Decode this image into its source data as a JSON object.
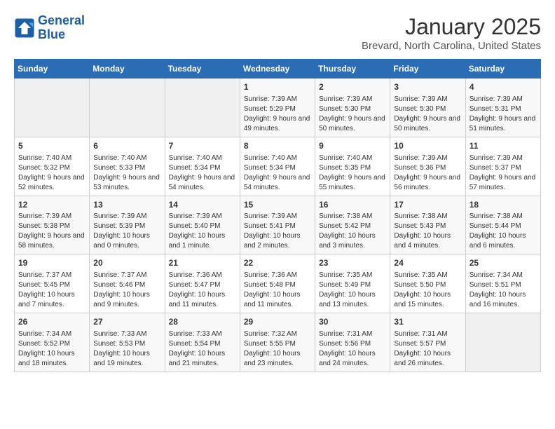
{
  "logo": {
    "line1": "General",
    "line2": "Blue"
  },
  "title": "January 2025",
  "subtitle": "Brevard, North Carolina, United States",
  "days_of_week": [
    "Sunday",
    "Monday",
    "Tuesday",
    "Wednesday",
    "Thursday",
    "Friday",
    "Saturday"
  ],
  "weeks": [
    [
      {
        "day": "",
        "sunrise": "",
        "sunset": "",
        "daylight": "",
        "empty": true
      },
      {
        "day": "",
        "sunrise": "",
        "sunset": "",
        "daylight": "",
        "empty": true
      },
      {
        "day": "",
        "sunrise": "",
        "sunset": "",
        "daylight": "",
        "empty": true
      },
      {
        "day": "1",
        "sunrise": "Sunrise: 7:39 AM",
        "sunset": "Sunset: 5:29 PM",
        "daylight": "Daylight: 9 hours and 49 minutes.",
        "empty": false
      },
      {
        "day": "2",
        "sunrise": "Sunrise: 7:39 AM",
        "sunset": "Sunset: 5:30 PM",
        "daylight": "Daylight: 9 hours and 50 minutes.",
        "empty": false
      },
      {
        "day": "3",
        "sunrise": "Sunrise: 7:39 AM",
        "sunset": "Sunset: 5:30 PM",
        "daylight": "Daylight: 9 hours and 50 minutes.",
        "empty": false
      },
      {
        "day": "4",
        "sunrise": "Sunrise: 7:39 AM",
        "sunset": "Sunset: 5:31 PM",
        "daylight": "Daylight: 9 hours and 51 minutes.",
        "empty": false
      }
    ],
    [
      {
        "day": "5",
        "sunrise": "Sunrise: 7:40 AM",
        "sunset": "Sunset: 5:32 PM",
        "daylight": "Daylight: 9 hours and 52 minutes.",
        "empty": false
      },
      {
        "day": "6",
        "sunrise": "Sunrise: 7:40 AM",
        "sunset": "Sunset: 5:33 PM",
        "daylight": "Daylight: 9 hours and 53 minutes.",
        "empty": false
      },
      {
        "day": "7",
        "sunrise": "Sunrise: 7:40 AM",
        "sunset": "Sunset: 5:34 PM",
        "daylight": "Daylight: 9 hours and 54 minutes.",
        "empty": false
      },
      {
        "day": "8",
        "sunrise": "Sunrise: 7:40 AM",
        "sunset": "Sunset: 5:34 PM",
        "daylight": "Daylight: 9 hours and 54 minutes.",
        "empty": false
      },
      {
        "day": "9",
        "sunrise": "Sunrise: 7:40 AM",
        "sunset": "Sunset: 5:35 PM",
        "daylight": "Daylight: 9 hours and 55 minutes.",
        "empty": false
      },
      {
        "day": "10",
        "sunrise": "Sunrise: 7:39 AM",
        "sunset": "Sunset: 5:36 PM",
        "daylight": "Daylight: 9 hours and 56 minutes.",
        "empty": false
      },
      {
        "day": "11",
        "sunrise": "Sunrise: 7:39 AM",
        "sunset": "Sunset: 5:37 PM",
        "daylight": "Daylight: 9 hours and 57 minutes.",
        "empty": false
      }
    ],
    [
      {
        "day": "12",
        "sunrise": "Sunrise: 7:39 AM",
        "sunset": "Sunset: 5:38 PM",
        "daylight": "Daylight: 9 hours and 58 minutes.",
        "empty": false
      },
      {
        "day": "13",
        "sunrise": "Sunrise: 7:39 AM",
        "sunset": "Sunset: 5:39 PM",
        "daylight": "Daylight: 10 hours and 0 minutes.",
        "empty": false
      },
      {
        "day": "14",
        "sunrise": "Sunrise: 7:39 AM",
        "sunset": "Sunset: 5:40 PM",
        "daylight": "Daylight: 10 hours and 1 minute.",
        "empty": false
      },
      {
        "day": "15",
        "sunrise": "Sunrise: 7:39 AM",
        "sunset": "Sunset: 5:41 PM",
        "daylight": "Daylight: 10 hours and 2 minutes.",
        "empty": false
      },
      {
        "day": "16",
        "sunrise": "Sunrise: 7:38 AM",
        "sunset": "Sunset: 5:42 PM",
        "daylight": "Daylight: 10 hours and 3 minutes.",
        "empty": false
      },
      {
        "day": "17",
        "sunrise": "Sunrise: 7:38 AM",
        "sunset": "Sunset: 5:43 PM",
        "daylight": "Daylight: 10 hours and 4 minutes.",
        "empty": false
      },
      {
        "day": "18",
        "sunrise": "Sunrise: 7:38 AM",
        "sunset": "Sunset: 5:44 PM",
        "daylight": "Daylight: 10 hours and 6 minutes.",
        "empty": false
      }
    ],
    [
      {
        "day": "19",
        "sunrise": "Sunrise: 7:37 AM",
        "sunset": "Sunset: 5:45 PM",
        "daylight": "Daylight: 10 hours and 7 minutes.",
        "empty": false
      },
      {
        "day": "20",
        "sunrise": "Sunrise: 7:37 AM",
        "sunset": "Sunset: 5:46 PM",
        "daylight": "Daylight: 10 hours and 9 minutes.",
        "empty": false
      },
      {
        "day": "21",
        "sunrise": "Sunrise: 7:36 AM",
        "sunset": "Sunset: 5:47 PM",
        "daylight": "Daylight: 10 hours and 11 minutes.",
        "empty": false
      },
      {
        "day": "22",
        "sunrise": "Sunrise: 7:36 AM",
        "sunset": "Sunset: 5:48 PM",
        "daylight": "Daylight: 10 hours and 11 minutes.",
        "empty": false
      },
      {
        "day": "23",
        "sunrise": "Sunrise: 7:35 AM",
        "sunset": "Sunset: 5:49 PM",
        "daylight": "Daylight: 10 hours and 13 minutes.",
        "empty": false
      },
      {
        "day": "24",
        "sunrise": "Sunrise: 7:35 AM",
        "sunset": "Sunset: 5:50 PM",
        "daylight": "Daylight: 10 hours and 15 minutes.",
        "empty": false
      },
      {
        "day": "25",
        "sunrise": "Sunrise: 7:34 AM",
        "sunset": "Sunset: 5:51 PM",
        "daylight": "Daylight: 10 hours and 16 minutes.",
        "empty": false
      }
    ],
    [
      {
        "day": "26",
        "sunrise": "Sunrise: 7:34 AM",
        "sunset": "Sunset: 5:52 PM",
        "daylight": "Daylight: 10 hours and 18 minutes.",
        "empty": false
      },
      {
        "day": "27",
        "sunrise": "Sunrise: 7:33 AM",
        "sunset": "Sunset: 5:53 PM",
        "daylight": "Daylight: 10 hours and 19 minutes.",
        "empty": false
      },
      {
        "day": "28",
        "sunrise": "Sunrise: 7:33 AM",
        "sunset": "Sunset: 5:54 PM",
        "daylight": "Daylight: 10 hours and 21 minutes.",
        "empty": false
      },
      {
        "day": "29",
        "sunrise": "Sunrise: 7:32 AM",
        "sunset": "Sunset: 5:55 PM",
        "daylight": "Daylight: 10 hours and 23 minutes.",
        "empty": false
      },
      {
        "day": "30",
        "sunrise": "Sunrise: 7:31 AM",
        "sunset": "Sunset: 5:56 PM",
        "daylight": "Daylight: 10 hours and 24 minutes.",
        "empty": false
      },
      {
        "day": "31",
        "sunrise": "Sunrise: 7:31 AM",
        "sunset": "Sunset: 5:57 PM",
        "daylight": "Daylight: 10 hours and 26 minutes.",
        "empty": false
      },
      {
        "day": "",
        "sunrise": "",
        "sunset": "",
        "daylight": "",
        "empty": true
      }
    ]
  ]
}
